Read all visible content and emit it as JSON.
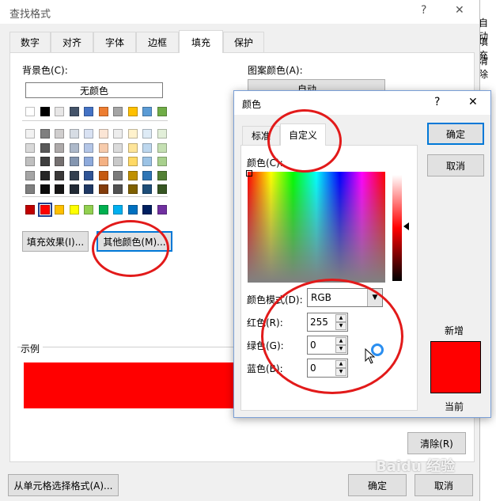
{
  "main_dialog": {
    "title": "查找格式",
    "help": "?",
    "close": "✕",
    "tabs": [
      "数字",
      "对齐",
      "字体",
      "边框",
      "填充",
      "保护"
    ],
    "background_color_label": "背景色(C):",
    "no_color": "无颜色",
    "pattern_color_label": "图案颜色(A):",
    "pattern_color_value": "自动",
    "fill_effects_button": "填充效果(I)...",
    "more_colors_button": "其他颜色(M)...",
    "sample_label": "示例",
    "sample_color": "#ff0000",
    "clear_button": "清除(R)",
    "from_cell_button": "从单元格选择格式(A)...",
    "ok_button": "确定",
    "cancel_button": "取消"
  },
  "right_edge_text": [
    "自动",
    "填充",
    "清除"
  ],
  "palette": {
    "theme_row": [
      "#ffffff",
      "#000000",
      "#e7e6e6",
      "#44546a",
      "#4472c4",
      "#ed7d31",
      "#a5a5a5",
      "#ffc000",
      "#5b9bd5",
      "#70ad47"
    ],
    "tints": [
      [
        "#f2f2f2",
        "#7f7f7f",
        "#d0cece",
        "#d6dce4",
        "#d9e2f3",
        "#fbe5d5",
        "#ededed",
        "#fff2cc",
        "#deebf6",
        "#e2efd9"
      ],
      [
        "#d9d9d9",
        "#595959",
        "#aeaaaa",
        "#adb9ca",
        "#b4c6e7",
        "#f7cbac",
        "#dbdbdb",
        "#fee599",
        "#bdd7ee",
        "#c5e0b3"
      ],
      [
        "#bfbfbf",
        "#3f3f3f",
        "#757070",
        "#8496b0",
        "#8eaadb",
        "#f4b183",
        "#c9c9c9",
        "#ffd965",
        "#9cc3e5",
        "#a8d08d"
      ],
      [
        "#a5a5a5",
        "#262626",
        "#3a3838",
        "#323f4f",
        "#2f5496",
        "#c55a11",
        "#7b7b7b",
        "#bf9000",
        "#2e75b5",
        "#538135"
      ],
      [
        "#7f7f7f",
        "#0c0c0c",
        "#171616",
        "#222a35",
        "#1f3864",
        "#833c0b",
        "#525252",
        "#7f6000",
        "#1e4e79",
        "#375623"
      ]
    ],
    "standard_row": [
      "#c00000",
      "#ff0000",
      "#ffc000",
      "#ffff00",
      "#92d050",
      "#00b050",
      "#00b0f0",
      "#0070c0",
      "#002060",
      "#7030a0"
    ]
  },
  "color_dialog": {
    "title": "颜色",
    "help": "?",
    "close": "✕",
    "tabs": [
      "标准",
      "自定义"
    ],
    "colors_label": "颜色(C):",
    "mode_label": "颜色模式(D):",
    "mode_value": "RGB",
    "red_label": "红色(R):",
    "red_value": "255",
    "green_label": "绿色(G):",
    "green_value": "0",
    "blue_label": "蓝色(B):",
    "blue_value": "0",
    "ok_button": "确定",
    "cancel_button": "取消",
    "new_label": "新增",
    "current_label": "当前",
    "new_color": "#ff0000",
    "current_color": "#ff0000"
  }
}
